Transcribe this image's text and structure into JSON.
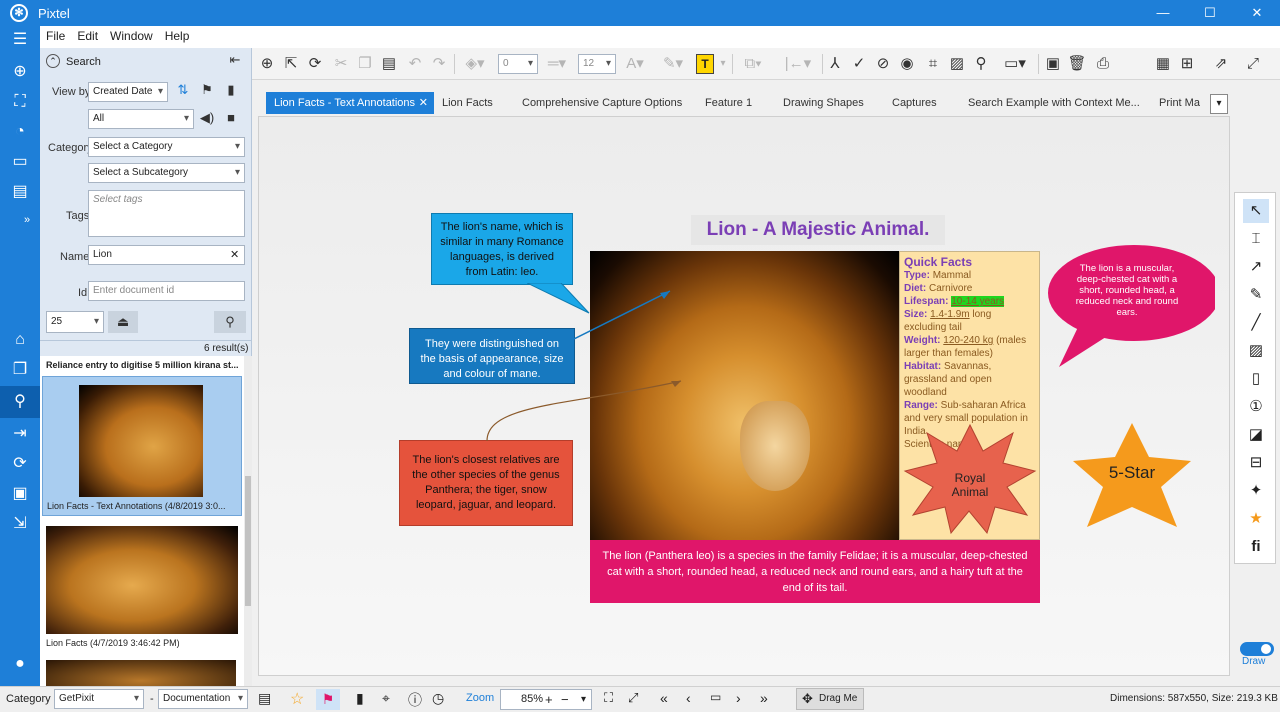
{
  "app": {
    "title": "Pixtel",
    "logo": "pixtel-logo-icon"
  },
  "window_controls": {
    "minimize": "—",
    "maximize": "☐",
    "close": "✕"
  },
  "menu": [
    "File",
    "Edit",
    "Window",
    "Help"
  ],
  "search": {
    "header": "Search",
    "view_by_label": "View by",
    "view_by_value": "Created Date",
    "filter_value": "All",
    "category_label": "Category",
    "category_placeholder": "Select a Category",
    "subcategory_placeholder": "Select a Subcategory",
    "tags_label": "Tags",
    "tags_placeholder": "Select tags",
    "name_label": "Name",
    "name_value": "Lion",
    "id_label": "Id",
    "id_placeholder": "Enter document id",
    "page_size": "25",
    "results": "6 result(s)",
    "result_items": [
      {
        "caption": "Reliance entry to digitise 5 million kirana st..."
      },
      {
        "caption": "Lion Facts - Text Annotations (4/8/2019 3:0..."
      },
      {
        "caption": "Lion Facts (4/7/2019 3:46:42 PM)"
      }
    ]
  },
  "toolbar": {
    "font_size": "12",
    "spacing": "0",
    "highlight_label": "T"
  },
  "tabs": [
    {
      "label": "Lion Facts - Text Annotations",
      "active": true
    },
    {
      "label": "Lion Facts"
    },
    {
      "label": "Comprehensive Capture Options"
    },
    {
      "label": "Feature 1"
    },
    {
      "label": "Drawing Shapes"
    },
    {
      "label": "Captures"
    },
    {
      "label": "Search Example with Context Me..."
    },
    {
      "label": "Print Ma"
    }
  ],
  "document": {
    "title": "Lion - A Majestic Animal.",
    "callout_name": "The lion's name, which is similar in many Romance languages, is derived from Latin: leo.",
    "callout_mane": "They were distinguished on the basis of appearance, size and colour of mane.",
    "callout_relatives": "The lion's closest relatives are the other species of the genus Panthera; the tiger, snow leopard, jaguar, and leopard.",
    "bubble_pink": "The lion is a muscular, deep-chested cat with a short, rounded head, a reduced neck and round ears.",
    "caption": "The lion (Panthera leo) is a species in the family Felidae; it is a muscular, deep-chested cat with a short, rounded head, a reduced neck and round ears, and a hairy tuft at the end of its tail.",
    "quick_facts": {
      "title": "Quick Facts",
      "type_label": "Type:",
      "type_value": " Mammal",
      "diet_label": "Diet:",
      "diet_value": " Carnivore",
      "lifespan_label": "Lifespan:",
      "lifespan_value": "10-14 years",
      "size_label": "Size:",
      "size_value": "1.4-1.9m",
      "size_rest": " long excluding tail",
      "weight_label": "Weight:",
      "weight_value": "120-240 kg",
      "weight_rest": " (males larger than females)",
      "habitat_label": "Habitat:",
      "habitat_value": " Savannas, grassland and open woodland",
      "range_label": "Range:",
      "range_value": " Sub-saharan Africa and very small population in India.",
      "sci_label": "Scientific name"
    },
    "burst_label": "Royal Animal",
    "star_label": "5-Star"
  },
  "right_tools": {
    "draw_label": "Draw"
  },
  "status": {
    "category_label": "Category",
    "category_value": "GetPixit",
    "dash": "-",
    "subcategory_value": "Documentation",
    "zoom_label": "Zoom",
    "zoom_value": "85%",
    "drag_label": "Drag Me",
    "dimensions": "Dimensions: 587x550, Size: 219.3 KB"
  },
  "colors": {
    "accent": "#1e7fd8",
    "pink": "#e0166a",
    "orange_star": "#f59a1c",
    "callout_blue": "#1aa7e8",
    "callout_steel": "#1779c0",
    "callout_red": "#e5533c",
    "title_purple": "#7b3fb5"
  }
}
